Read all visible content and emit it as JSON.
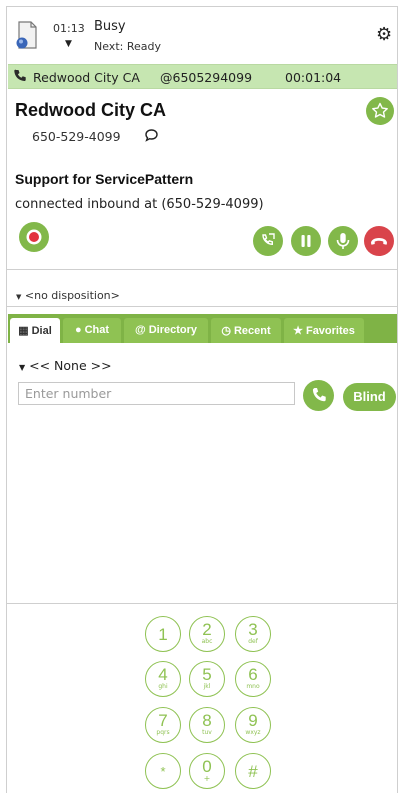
{
  "header": {
    "timer": "01:13",
    "state": "Busy",
    "next_state": "Next: Ready",
    "icons": {
      "agent": "agent-status-icon",
      "settings": "gear-icon",
      "caret": "caret-down-icon"
    }
  },
  "active_call": {
    "location": "Redwood City CA",
    "number": "@6505294099",
    "duration": "00:01:04",
    "icon": "phone-icon"
  },
  "contact": {
    "name": "Redwood City CA",
    "phone": "650-529-4099",
    "service": "Support for ServicePattern",
    "status": "connected inbound at (650-529-4099)"
  },
  "call_controls": [
    {
      "name": "record",
      "icon": "record-icon"
    },
    {
      "name": "transfer",
      "icon": "transfer-icon"
    },
    {
      "name": "hold",
      "icon": "pause-icon"
    },
    {
      "name": "mute",
      "icon": "microphone-icon"
    },
    {
      "name": "hangup",
      "icon": "hangup-icon"
    }
  ],
  "disposition": {
    "value": "<no disposition>"
  },
  "tabs": [
    {
      "label": "Dial",
      "icon": "grid-icon",
      "active": true
    },
    {
      "label": "Chat",
      "icon": "chat-icon",
      "active": false
    },
    {
      "label": "Directory",
      "icon": "at-icon",
      "active": false
    },
    {
      "label": "Recent",
      "icon": "clock-icon",
      "active": false
    },
    {
      "label": "Favorites",
      "icon": "star-icon",
      "active": false
    }
  ],
  "dial": {
    "selector": "<< None >>",
    "placeholder": "Enter number",
    "value": "",
    "blind_label": "Blind"
  },
  "keypad": [
    {
      "digit": "1",
      "letters": ""
    },
    {
      "digit": "2",
      "letters": "abc"
    },
    {
      "digit": "3",
      "letters": "def"
    },
    {
      "digit": "4",
      "letters": "ghi"
    },
    {
      "digit": "5",
      "letters": "jkl"
    },
    {
      "digit": "6",
      "letters": "mno"
    },
    {
      "digit": "7",
      "letters": "pqrs"
    },
    {
      "digit": "8",
      "letters": "tuv"
    },
    {
      "digit": "9",
      "letters": "wxyz"
    },
    {
      "digit": "*",
      "letters": ""
    },
    {
      "digit": "0",
      "letters": "+"
    },
    {
      "digit": "#",
      "letters": ""
    }
  ],
  "colors": {
    "accent": "#82b84a",
    "tab_bar": "#7fb346",
    "call_bar": "#c6e6b1",
    "record": "#e2343f",
    "hangup": "#d9444b"
  }
}
